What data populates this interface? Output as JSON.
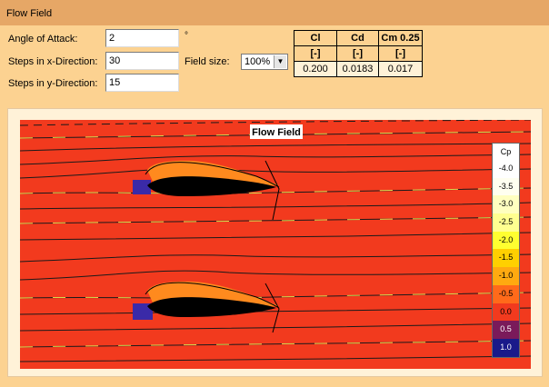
{
  "header": {
    "title": "Flow Field"
  },
  "form": {
    "angle_label": "Angle of Attack:",
    "angle_value": "2",
    "angle_unit": "°",
    "stepsx_label": "Steps in x-Direction:",
    "stepsx_value": "30",
    "stepsy_label": "Steps in y-Direction:",
    "stepsy_value": "15",
    "fieldsize_label": "Field size:",
    "fieldsize_value": "100%"
  },
  "coefficients": {
    "headers": [
      "Cl",
      "Cd",
      "Cm 0.25"
    ],
    "units": [
      "[-]",
      "[-]",
      "[-]"
    ],
    "values": [
      "0.200",
      "0.0183",
      "0.017"
    ]
  },
  "plot": {
    "title": "Flow Field"
  },
  "legend": {
    "title": "Cp",
    "items": [
      {
        "label": "-4.0",
        "color": "#ffffff"
      },
      {
        "label": "-3.5",
        "color": "#fffff0"
      },
      {
        "label": "-3.0",
        "color": "#ffffc0"
      },
      {
        "label": "-2.5",
        "color": "#ffff90"
      },
      {
        "label": "-2.0",
        "color": "#ffff30"
      },
      {
        "label": "-1.5",
        "color": "#ffd000"
      },
      {
        "label": "-1.0",
        "color": "#ffaa10"
      },
      {
        "label": "-0.5",
        "color": "#ff6a1a"
      },
      {
        "label": "0.0",
        "color": "#f23a1e"
      },
      {
        "label": "0.5",
        "color": "#7a1a5a"
      },
      {
        "label": "1.0",
        "color": "#1a1a8a"
      }
    ]
  },
  "colors": {
    "header_bg": "#e6a766",
    "page_bg": "#fcd291",
    "field": "#f23a1e",
    "suction": "#ff8a1e",
    "stagnation": "#3a2aa8",
    "streamline_dark": "#1a1a1a",
    "streamline_light": "#d8d850"
  }
}
